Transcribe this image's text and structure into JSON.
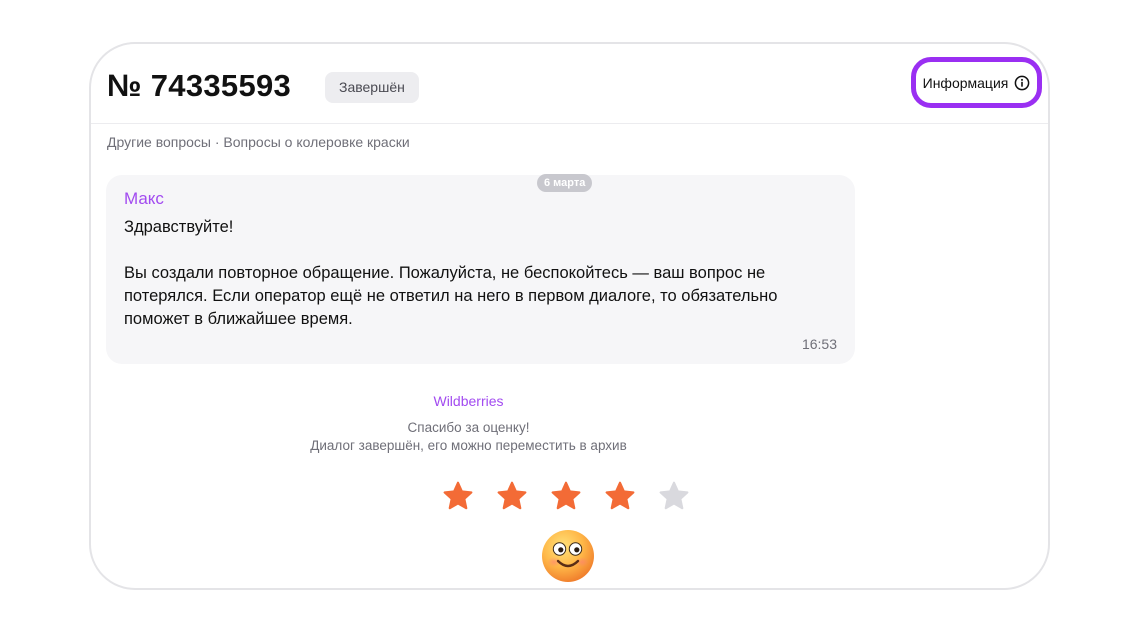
{
  "ticket": {
    "title": "№ 74335593",
    "status": "Завершён",
    "info_button": "Информация",
    "breadcrumb": "Другие вопросы · Вопросы о колеровке краски"
  },
  "message": {
    "date": "6 марта",
    "sender": "Макс",
    "paragraphs": [
      "Здравствуйте!",
      "Вы создали повторное обращение. Пожалуйста, не беспокойтесь — ваш вопрос не потерялся. Если оператор ещё не ответил на него в первом диалоге, то обязательно поможет в ближайшее время."
    ],
    "time": "16:53"
  },
  "system": {
    "brand": "Wildberries",
    "thanks": "Спасибо за оценку!",
    "closed_note": "Диалог завершён, его можно переместить в архив"
  },
  "rating": {
    "value": 4,
    "max": 5,
    "filled_color": "#f36b36",
    "empty_color": "#d9d9de"
  },
  "icons": {
    "info": "info-circle-icon",
    "star": "star-icon",
    "emoji": "smiling-face-emoji"
  },
  "colors": {
    "accent": "#9a2ff2",
    "sender": "#a24bf0"
  }
}
